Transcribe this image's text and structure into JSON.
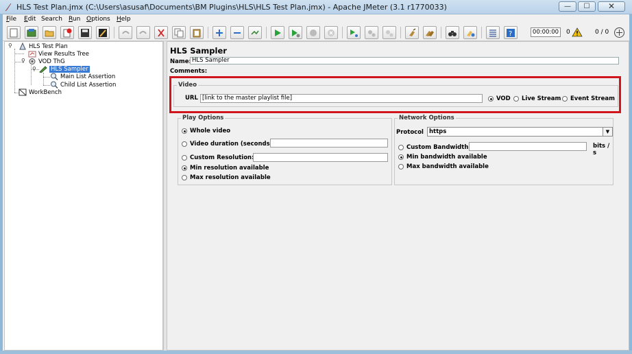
{
  "window": {
    "title": "HLS Test Plan.jmx (C:\\Users\\asusaf\\Documents\\BM Plugins\\HLS\\HLS Test Plan.jmx) - Apache JMeter (3.1 r1770033)",
    "min_glyph": "—",
    "max_glyph": "☐",
    "close_glyph": "✕"
  },
  "menu": {
    "file": {
      "key": "F",
      "rest": "ile"
    },
    "edit": {
      "key": "E",
      "rest": "dit"
    },
    "search": {
      "key": "",
      "rest": "Search"
    },
    "run": {
      "key": "R",
      "rest": "un"
    },
    "options": {
      "key": "O",
      "rest": "ptions"
    },
    "help": {
      "key": "H",
      "rest": "elp"
    }
  },
  "toolbar": {
    "timer": "00:00:00",
    "warning_count": "0",
    "thread_count": "0 / 0"
  },
  "tree": {
    "test_plan": "HLS Test Plan",
    "view_results_tree": "View Results Tree",
    "vod_thg": "VOD ThG",
    "hls_sampler": "HLS Sampler",
    "main_list_assertion": "Main List Assertion",
    "child_list_assertion": "Child List Assertion",
    "workbench": "WorkBench"
  },
  "panel": {
    "title": "HLS Sampler",
    "name_label": "Name:",
    "name_value": "HLS Sampler",
    "comments_label": "Comments:"
  },
  "video": {
    "legend": "Video",
    "url_label": "URL",
    "url_value": "[link to the master playlist file]",
    "types": [
      {
        "label": "VOD",
        "selected": true
      },
      {
        "label": "Live Stream",
        "selected": false
      },
      {
        "label": "Event Stream",
        "selected": false
      }
    ]
  },
  "play_options": {
    "legend": "Play Options",
    "whole_video": "Whole video",
    "video_duration": "Video duration (seconds):",
    "custom_resolution": "Custom Resolution:",
    "min_resolution": "Min resolution available",
    "max_resolution": "Max resolution available",
    "selected_duration": "whole_video",
    "selected_resolution": "min_resolution"
  },
  "network_options": {
    "legend": "Network Options",
    "protocol_label": "Protocol",
    "protocol_value": "https",
    "custom_bandwidth": "Custom Bandwidth:",
    "bandwidth_unit": "bits / s",
    "min_bandwidth": "Min bandwidth available",
    "max_bandwidth": "Max bandwidth available",
    "selected_bandwidth": "min_bandwidth"
  },
  "colors": {
    "highlight": "#d0161c",
    "selection": "#3a7bd5"
  }
}
